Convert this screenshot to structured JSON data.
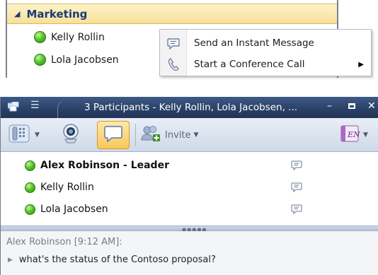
{
  "contact_list": {
    "group": {
      "label": "Marketing",
      "expanded": true
    },
    "contacts": [
      {
        "name": "Kelly Rollin",
        "presence": "available"
      },
      {
        "name": "Lola Jacobsen",
        "presence": "available"
      }
    ]
  },
  "context_menu": {
    "items": [
      {
        "label": "Send an Instant Message",
        "icon": "instant-message-icon",
        "submenu": false
      },
      {
        "label": "Start a Conference Call",
        "icon": "phone-handset-icon",
        "submenu": true
      }
    ]
  },
  "conversation_window": {
    "title": "3 Participants - Kelly Rollin, Lola Jacobsen, ...",
    "toolbar": {
      "invite_label": "Invite"
    },
    "participants": [
      {
        "name": "Alex Robinson - Leader",
        "bold": true,
        "presence": "available"
      },
      {
        "name": "Kelly Rollin",
        "bold": false,
        "presence": "available"
      },
      {
        "name": "Lola Jacobsen",
        "bold": false,
        "presence": "available"
      }
    ],
    "messages": [
      {
        "sender_line": "Alex Robinson [9:12 AM]:",
        "text": "what's the status of the Contoso proposal?"
      }
    ]
  },
  "colors": {
    "group_header_bg": "#f8e09a",
    "group_label": "#1a3b77",
    "presence_available": "#56c72a",
    "titlebar": "#2a4066",
    "im_button_active": "#f9c75a"
  }
}
